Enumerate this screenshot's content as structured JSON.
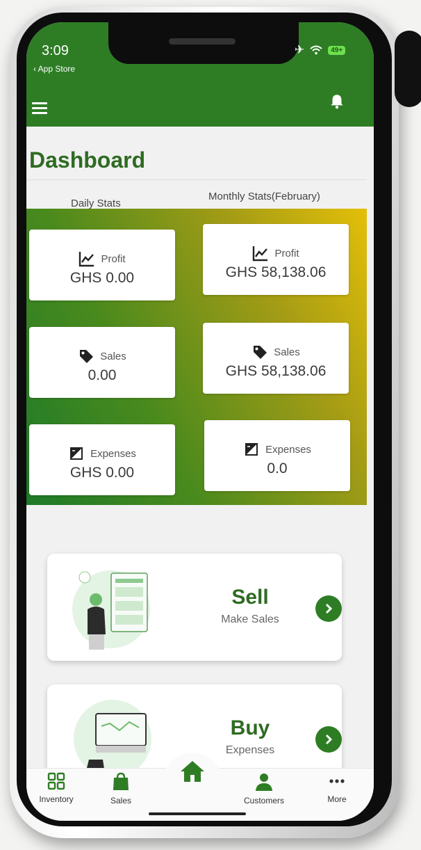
{
  "status_bar": {
    "time": "3:09",
    "back_label": "App Store",
    "battery": "49+"
  },
  "dashboard": {
    "title": "Dashboard",
    "daily_label": "Daily Stats",
    "monthly_label": "Monthly Stats(February)",
    "daily": [
      {
        "label": "Profit",
        "value": "GHS 0.00",
        "icon": "chart-line-icon"
      },
      {
        "label": "Sales",
        "value": "0.00",
        "icon": "tag-icon"
      },
      {
        "label": "Expenses",
        "value": "GHS 0.00",
        "icon": "expenses-icon"
      }
    ],
    "monthly": [
      {
        "label": "Profit",
        "value": "GHS 58,138.06",
        "icon": "chart-line-icon"
      },
      {
        "label": "Sales",
        "value": "GHS 58,138.06",
        "icon": "tag-icon"
      },
      {
        "label": "Expenses",
        "value": "0.0",
        "icon": "expenses-icon"
      }
    ]
  },
  "actions": [
    {
      "title": "Sell",
      "subtitle": "Make Sales"
    },
    {
      "title": "Buy",
      "subtitle": "Expenses"
    }
  ],
  "bottom_nav": [
    {
      "label": "Inventory",
      "icon": "grid-icon"
    },
    {
      "label": "Sales",
      "icon": "shopping-bag-icon"
    },
    {
      "label": "",
      "icon": "home-icon"
    },
    {
      "label": "Customers",
      "icon": "person-icon"
    },
    {
      "label": "More",
      "icon": "more-dots-icon"
    }
  ],
  "colors": {
    "primary_green": "#2e7d25",
    "title_green": "#2e6b22",
    "gradient_start": "#1d7a29",
    "gradient_end": "#e4bf08"
  }
}
